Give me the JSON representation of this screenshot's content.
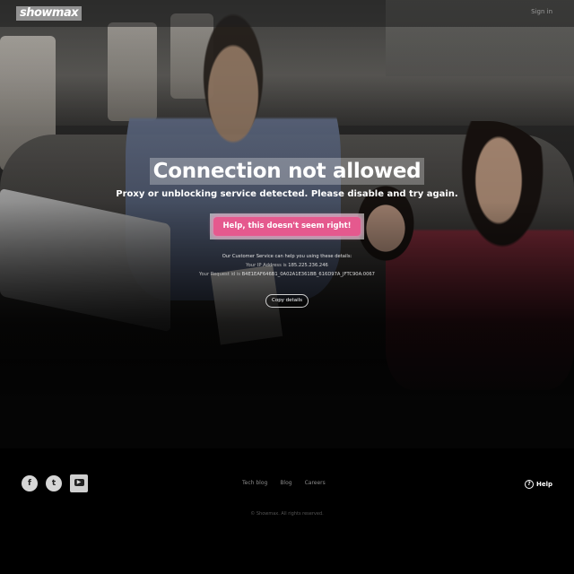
{
  "header": {
    "logo_text": "showmax",
    "signin_label": "Sign in"
  },
  "main": {
    "title": "Connection not allowed",
    "subtitle": "Proxy or unblocking service detected. Please disable and try again.",
    "help_button_label": "Help, this doesn't seem right!",
    "customer_service_text": "Our Customer Service can help you using these details:",
    "ip_label": "Your IP Address is",
    "ip_value": "185.225.236.246",
    "request_label": "Your Request id is",
    "request_value": "B4E1EAF646B1_0A02A1E361BB_616D97A_JFTC90A:0067",
    "copy_button_label": "Copy details"
  },
  "footer": {
    "social": [
      {
        "name": "facebook",
        "glyph": "f"
      },
      {
        "name": "twitter",
        "glyph": "t"
      },
      {
        "name": "youtube",
        "glyph": "▶"
      }
    ],
    "links": [
      "Tech blog",
      "Blog",
      "Careers"
    ],
    "help_label": "Help",
    "copyright": "© Showmax. All rights reserved."
  },
  "colors": {
    "accent_pink": "#e5598e",
    "background": "#000000"
  }
}
